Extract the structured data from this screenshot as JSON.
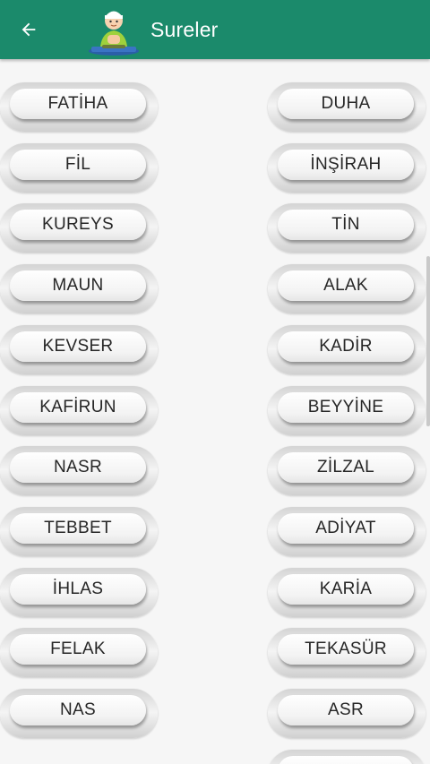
{
  "header": {
    "title": "Sureler",
    "back_icon": "arrow-left-icon",
    "logo_icon": "praying-boy-icon",
    "color": "#1b8a6b"
  },
  "surahs_left": [
    "FATİHA",
    "FİL",
    "KUREYS",
    "MAUN",
    "KEVSER",
    "KAFİRUN",
    "NASR",
    "TEBBET",
    "İHLAS",
    "FELAK",
    "NAS"
  ],
  "surahs_right": [
    "DUHA",
    "İNŞİRAH",
    "TİN",
    "ALAK",
    "KADİR",
    "BEYYİNE",
    "ZİLZAL",
    "ADİYAT",
    "KARİA",
    "TEKASÜR",
    "ASR",
    ""
  ]
}
